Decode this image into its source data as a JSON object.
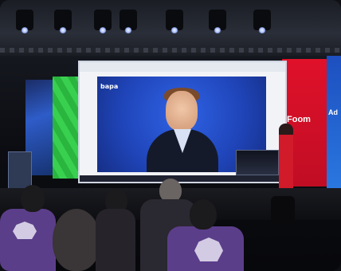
{
  "scene": {
    "screen_logo": "bapa",
    "right_wall_text": "Foom",
    "far_right_wall_text": "Ad"
  },
  "colors": {
    "screen_blue": "#2f63e6",
    "green_wall": "#29b53e",
    "red_wall": "#e0112a",
    "audience_shirt": "#5b3e8a"
  }
}
